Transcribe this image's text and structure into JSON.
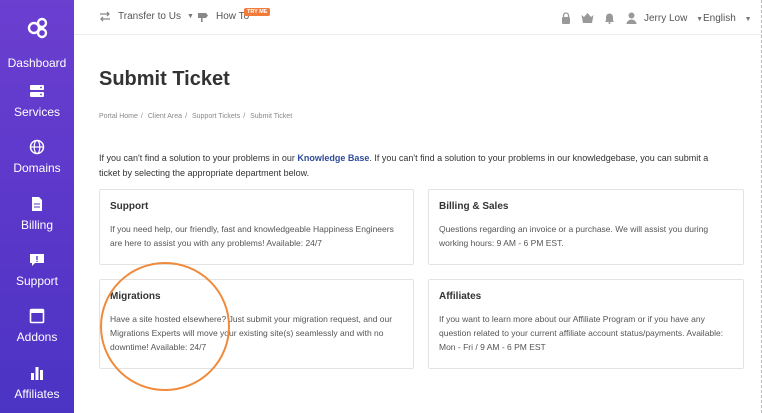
{
  "sidebar": {
    "items": [
      {
        "label": "Dashboard"
      },
      {
        "label": "Services"
      },
      {
        "label": "Domains"
      },
      {
        "label": "Billing"
      },
      {
        "label": "Support"
      },
      {
        "label": "Addons"
      },
      {
        "label": "Affiliates"
      }
    ]
  },
  "topbar": {
    "transfer_label": "Transfer to Us",
    "howto_label": "How To",
    "tryme_badge": "TRY ME",
    "user_name": "Jerry Low",
    "language": "English"
  },
  "page": {
    "title": "Submit Ticket",
    "breadcrumb": [
      "Portal Home",
      "Client Area",
      "Support Tickets",
      "Submit Ticket"
    ],
    "intro_before": "If you can't find a solution to your problems in our ",
    "intro_link": "Knowledge Base",
    "intro_after": ". If you can't find a solution to your problems in our knowledgebase, you can submit a ticket by selecting the appropriate department below."
  },
  "departments": [
    {
      "title": "Support",
      "description": "If you need help, our friendly, fast and knowledgeable Happiness Engineers are here to assist you with any problems! Available: 24/7"
    },
    {
      "title": "Billing & Sales",
      "description": "Questions regarding an invoice or a purchase. We will assist you during working hours: 9 AM - 6 PM EST."
    },
    {
      "title": "Migrations",
      "description": "Have a site hosted elsewhere? Just submit your migration request, and our Migrations Experts will move your existing site(s) seamlessly and with no downtime! Available: 24/7"
    },
    {
      "title": "Affiliates",
      "description": "If you want to learn more about our Affiliate Program or if you have any question related to your current affiliate account status/payments. Available: Mon - Fri / 9 AM - 6 PM EST"
    }
  ],
  "colors": {
    "sidebar": "#5a37c9",
    "link": "#2f4b9a",
    "badge": "#f47a3a",
    "annotation_circle": "#f08a3c"
  }
}
